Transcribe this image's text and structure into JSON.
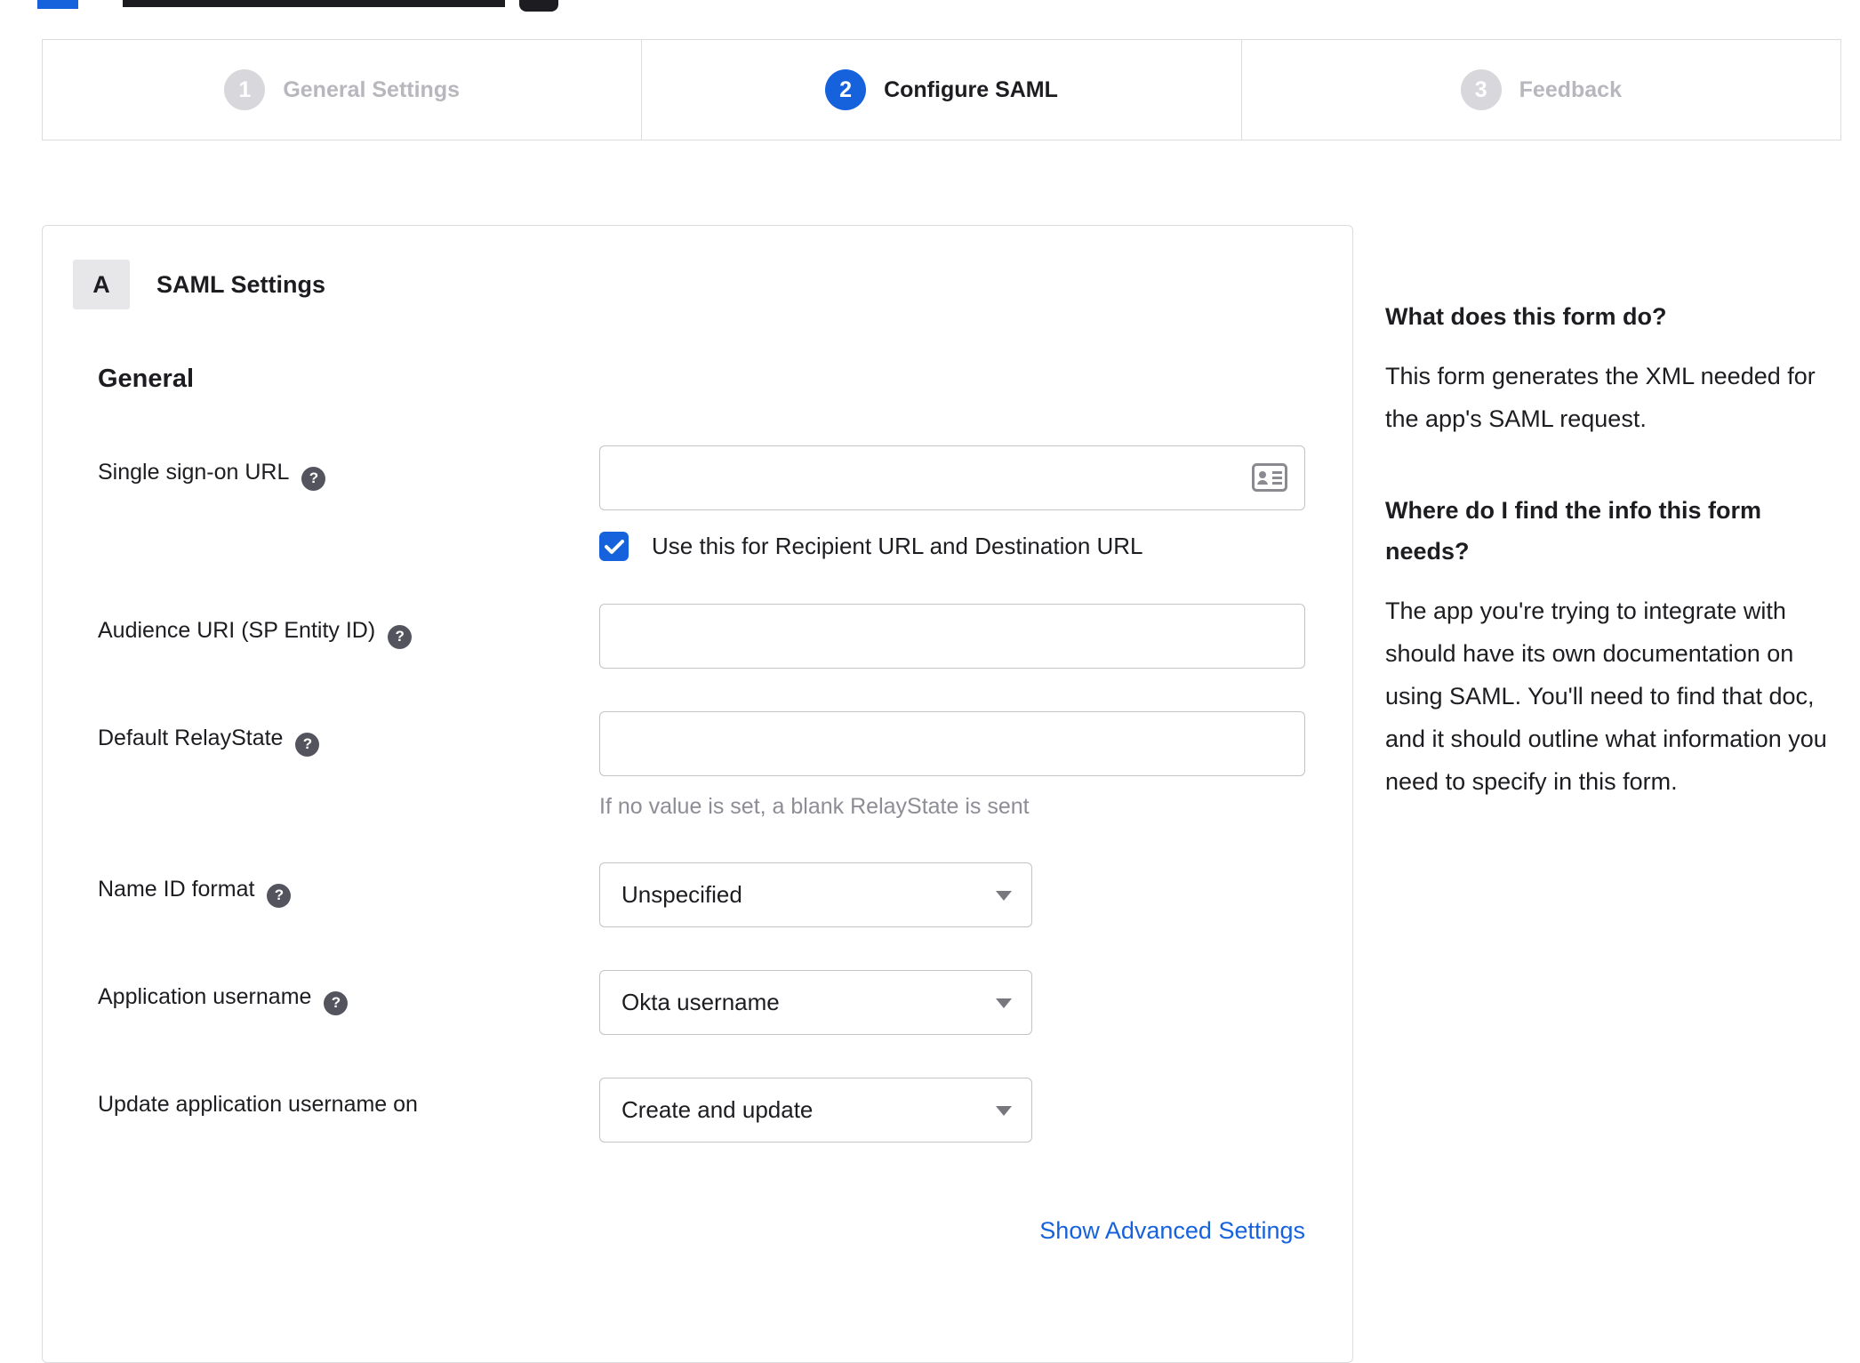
{
  "stepper": {
    "steps": [
      {
        "number": "1",
        "label": "General Settings",
        "state": "inactive"
      },
      {
        "number": "2",
        "label": "Configure SAML",
        "state": "active"
      },
      {
        "number": "3",
        "label": "Feedback",
        "state": "inactive"
      }
    ]
  },
  "panel": {
    "badge": "A",
    "title": "SAML Settings",
    "section_heading": "General",
    "fields": {
      "sso_url": {
        "label": "Single sign-on URL",
        "value": ""
      },
      "sso_checkbox": {
        "label": "Use this for Recipient URL and Destination URL",
        "checked": true
      },
      "audience_uri": {
        "label": "Audience URI (SP Entity ID)",
        "value": ""
      },
      "relay_state": {
        "label": "Default RelayState",
        "value": "",
        "hint": "If no value is set, a blank RelayState is sent"
      },
      "name_id_format": {
        "label": "Name ID format",
        "value": "Unspecified"
      },
      "app_username": {
        "label": "Application username",
        "value": "Okta username"
      },
      "update_app_username": {
        "label": "Update application username on",
        "value": "Create and update"
      }
    },
    "advanced_link": "Show Advanced Settings"
  },
  "sidebar": {
    "sections": [
      {
        "heading": "What does this form do?",
        "body": "This form generates the XML needed for the app's SAML request."
      },
      {
        "heading": "Where do I find the info this form needs?",
        "body": "The app you're trying to integrate with should have its own documentation on using SAML. You'll need to find that doc, and it should outline what information you need to specify in this form."
      }
    ]
  },
  "colors": {
    "accent": "#1662dd",
    "inactive_step": "#d7d7dc",
    "link": "#1662dd"
  }
}
